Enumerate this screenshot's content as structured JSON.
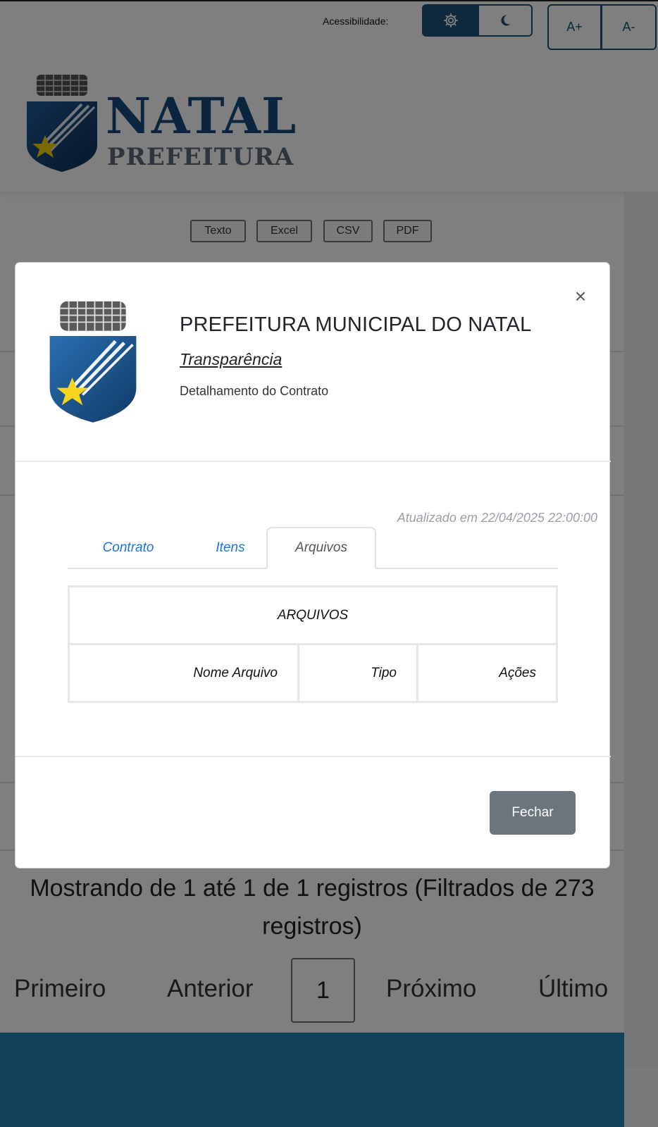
{
  "header": {
    "accessibility_label": "Acessibilidade:",
    "font_increase": "A+",
    "font_decrease": "A-",
    "logo_name": "NATAL",
    "logo_subtitle": "PREFEITURA",
    "icons": {
      "contrast": "gear-icon",
      "dark_mode": "moon-icon"
    },
    "colors": {
      "primary": "#1a5276",
      "logo_blue": "#174a7c"
    }
  },
  "export": {
    "buttons": [
      "Texto",
      "Excel",
      "CSV",
      "PDF"
    ]
  },
  "background_list": {
    "summary": "Mostrando de 1 até 1 de 1 registros (Filtrados de 273 registros)",
    "pagination": {
      "first": "Primeiro",
      "previous": "Anterior",
      "current": "1",
      "next": "Próximo",
      "last": "Último"
    }
  },
  "modal": {
    "title": "PREFEITURA MUNICIPAL DO NATAL",
    "subtitle": "Transparência",
    "description": "Detalhamento do Contrato",
    "close_symbol": "×",
    "updated": "Atualizado em 22/04/2025 22:00:00",
    "tabs": [
      {
        "label": "Contrato",
        "active": false
      },
      {
        "label": "Itens",
        "active": false
      },
      {
        "label": "Arquivos",
        "active": true
      }
    ],
    "table": {
      "caption": "ARQUIVOS",
      "columns": [
        "Nome Arquivo",
        "Tipo",
        "Ações"
      ]
    },
    "close_button": "Fechar"
  }
}
